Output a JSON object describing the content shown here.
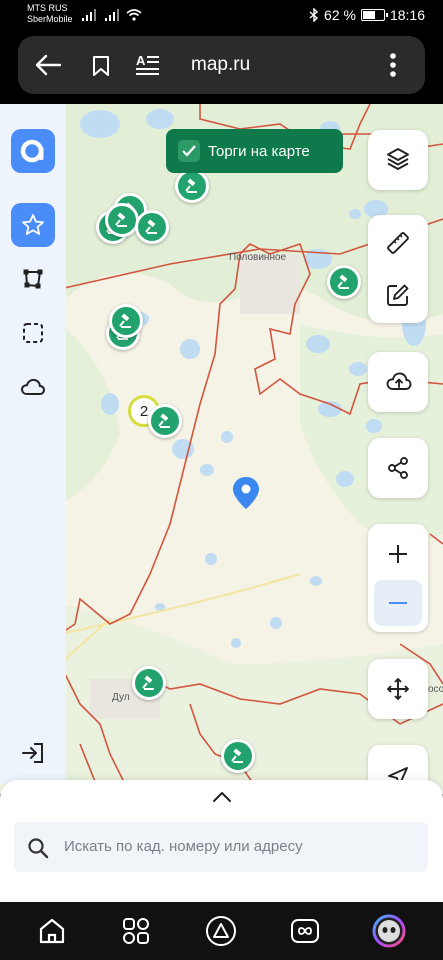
{
  "status": {
    "carrier1": "MTS RUS",
    "carrier2": "SberMobile",
    "battery": "62 %",
    "battery_level": 0.62,
    "time": "18:16"
  },
  "browser": {
    "url": "map.ru"
  },
  "map": {
    "tender_toggle_label": "Торги на карте",
    "place_label_1": "Половинное",
    "place_label_2": "Дул",
    "place_label_3": "осо",
    "cluster_count": "2"
  },
  "search": {
    "placeholder": "Искать по кад. номеру или адресу"
  },
  "colors": {
    "brand": "#4b8df8",
    "tender_green": "#0e7a4c",
    "marker_green": "#22a36d",
    "boundary_red": "#d2553f",
    "water": "#bfdcf3"
  }
}
